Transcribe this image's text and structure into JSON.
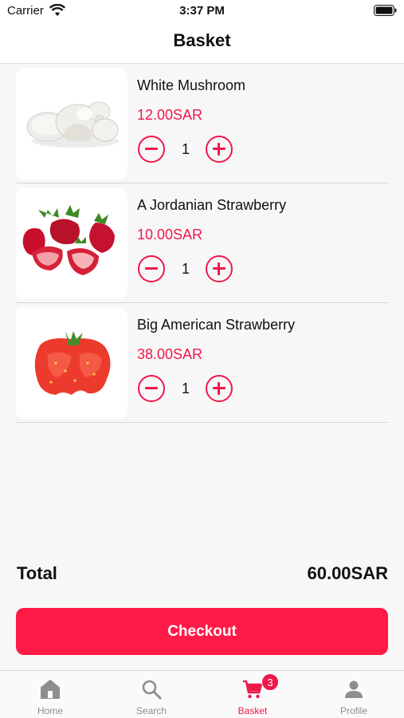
{
  "status_bar": {
    "carrier": "Carrier",
    "time": "3:37 PM",
    "icons": [
      "wifi-icon",
      "battery-icon"
    ]
  },
  "header": {
    "title": "Basket"
  },
  "basket": {
    "items": [
      {
        "name": "White Mushroom",
        "price": "12.00SAR",
        "quantity": "1",
        "image": "white-mushroom"
      },
      {
        "name": "A Jordanian Strawberry",
        "price": "10.00SAR",
        "quantity": "1",
        "image": "strawberries"
      },
      {
        "name": "Big American Strawberry",
        "price": "38.00SAR",
        "quantity": "1",
        "image": "big-strawberry"
      }
    ],
    "decrement_icon": "minus-circle-icon",
    "increment_icon": "plus-circle-icon"
  },
  "summary": {
    "total_label": "Total",
    "total_value": "60.00SAR"
  },
  "checkout": {
    "label": "Checkout"
  },
  "tab_bar": {
    "tabs": [
      {
        "label": "Home",
        "icon": "home-icon",
        "active": false
      },
      {
        "label": "Search",
        "icon": "search-icon",
        "active": false
      },
      {
        "label": "Basket",
        "icon": "cart-icon",
        "active": true,
        "badge": "3"
      },
      {
        "label": "Profile",
        "icon": "person-icon",
        "active": false
      }
    ]
  },
  "colors": {
    "accent": "#f0184b",
    "checkout_bg": "#ff1a48",
    "background": "#f7f7f7",
    "inactive_tab": "#8e8e8e"
  }
}
